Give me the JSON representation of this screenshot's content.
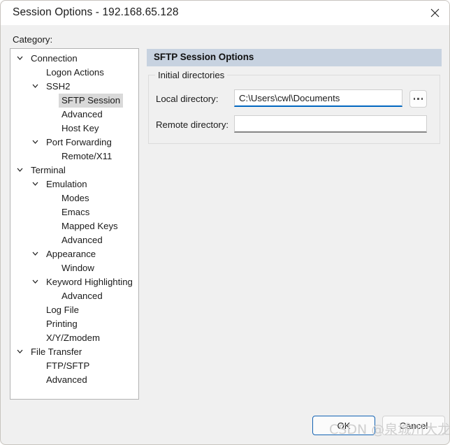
{
  "window": {
    "title": "Session Options - 192.168.65.128",
    "close_icon": "close-icon"
  },
  "sidebar": {
    "label": "Category:",
    "items": [
      {
        "label": "Connection",
        "level": 0,
        "expandable": true,
        "selected": false
      },
      {
        "label": "Logon Actions",
        "level": 1,
        "expandable": false,
        "selected": false
      },
      {
        "label": "SSH2",
        "level": 1,
        "expandable": true,
        "selected": false
      },
      {
        "label": "SFTP Session",
        "level": 2,
        "expandable": false,
        "selected": true
      },
      {
        "label": "Advanced",
        "level": 2,
        "expandable": false,
        "selected": false
      },
      {
        "label": "Host Key",
        "level": 2,
        "expandable": false,
        "selected": false
      },
      {
        "label": "Port Forwarding",
        "level": 1,
        "expandable": true,
        "selected": false
      },
      {
        "label": "Remote/X11",
        "level": 2,
        "expandable": false,
        "selected": false
      },
      {
        "label": "Terminal",
        "level": 0,
        "expandable": true,
        "selected": false
      },
      {
        "label": "Emulation",
        "level": 1,
        "expandable": true,
        "selected": false
      },
      {
        "label": "Modes",
        "level": 2,
        "expandable": false,
        "selected": false
      },
      {
        "label": "Emacs",
        "level": 2,
        "expandable": false,
        "selected": false
      },
      {
        "label": "Mapped Keys",
        "level": 2,
        "expandable": false,
        "selected": false
      },
      {
        "label": "Advanced",
        "level": 2,
        "expandable": false,
        "selected": false
      },
      {
        "label": "Appearance",
        "level": 1,
        "expandable": true,
        "selected": false
      },
      {
        "label": "Window",
        "level": 2,
        "expandable": false,
        "selected": false
      },
      {
        "label": "Keyword Highlighting",
        "level": 1,
        "expandable": true,
        "selected": false
      },
      {
        "label": "Advanced",
        "level": 2,
        "expandable": false,
        "selected": false
      },
      {
        "label": "Log File",
        "level": 1,
        "expandable": false,
        "selected": false
      },
      {
        "label": "Printing",
        "level": 1,
        "expandable": false,
        "selected": false
      },
      {
        "label": "X/Y/Zmodem",
        "level": 1,
        "expandable": false,
        "selected": false
      },
      {
        "label": "File Transfer",
        "level": 0,
        "expandable": true,
        "selected": false
      },
      {
        "label": "FTP/SFTP",
        "level": 1,
        "expandable": false,
        "selected": false
      },
      {
        "label": "Advanced",
        "level": 1,
        "expandable": false,
        "selected": false
      }
    ]
  },
  "pane": {
    "header": "SFTP Session Options",
    "group": {
      "legend": "Initial directories",
      "local": {
        "label": "Local directory:",
        "value": "C:\\Users\\cwl\\Documents",
        "placeholder": "",
        "focused": true
      },
      "remote": {
        "label": "Remote directory:",
        "value": "",
        "placeholder": "",
        "focused": false
      },
      "browse_label": "...",
      "browse_icon": "ellipsis-icon"
    }
  },
  "footer": {
    "ok_label": "OK",
    "cancel_label": "Cancel"
  },
  "watermark": {
    "text": "CSDN @泉城川大龙"
  },
  "colors": {
    "accent_focus": "#0067c0",
    "pane_header_bg": "#c7d2e0",
    "dialog_bg": "#f0f0f0",
    "selection_bg": "#d9d9d9",
    "default_button_border": "#1262b3"
  }
}
